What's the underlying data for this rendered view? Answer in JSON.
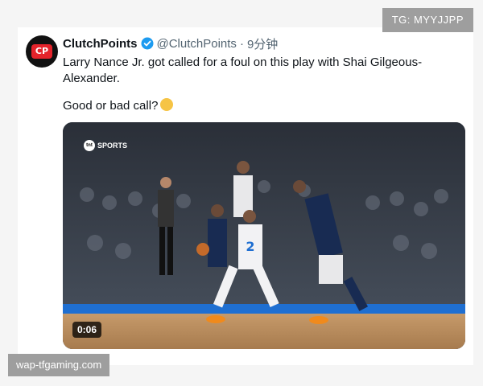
{
  "watermarks": {
    "top": "TG: MYYJJPP",
    "bottom": "wap-tfgaming.com"
  },
  "tweet": {
    "display_name": "ClutchPoints",
    "handle": "@ClutchPoints",
    "separator": "·",
    "time": "9分钟",
    "text_line1": "Larry Nance Jr. got called for a foul on this play with Shai Gilgeous-Alexander.",
    "text_line2": "Good or bad call?",
    "avatar_text": "CP",
    "verified_color": "#1d9bf0",
    "brand_color": "#e4232b"
  },
  "video": {
    "network_label": "SPORTS",
    "network_mark": "tnt",
    "duration": "0:06",
    "jersey_number": "2"
  }
}
